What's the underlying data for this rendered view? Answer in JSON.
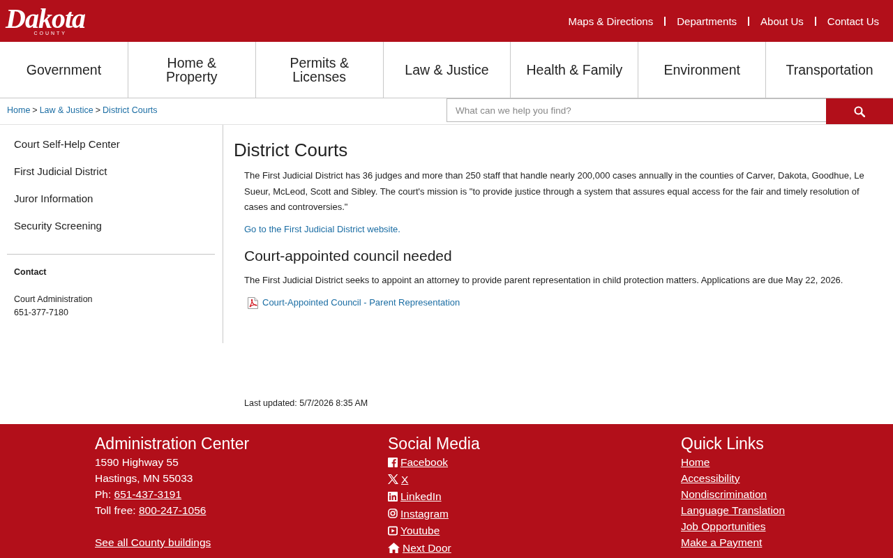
{
  "header": {
    "logo": {
      "wordmark": "Dakota",
      "subtitle": "COUNTY"
    },
    "top_links": [
      "Maps & Directions",
      "Departments",
      "About Us",
      "Contact Us"
    ]
  },
  "nav": [
    {
      "lines": [
        "Government"
      ]
    },
    {
      "lines": [
        "Home &",
        "Property"
      ]
    },
    {
      "lines": [
        "Permits &",
        "Licenses"
      ]
    },
    {
      "lines": [
        "Law & Justice"
      ]
    },
    {
      "lines": [
        "Health & Family"
      ]
    },
    {
      "lines": [
        "Environment"
      ]
    },
    {
      "lines": [
        "Transportation"
      ]
    }
  ],
  "breadcrumb": [
    {
      "label": "Home",
      "separator": ">"
    },
    {
      "label": "Law & Justice",
      "separator": ">"
    },
    {
      "label": "District Courts"
    }
  ],
  "search": {
    "placeholder": "What can we help you find?"
  },
  "sidebar": {
    "items": [
      "Court Self-Help Center",
      "First Judicial District",
      "Juror Information",
      "Security Screening"
    ],
    "contact": {
      "heading": "Contact",
      "lines": [
        "Court Administration",
        "651-377-7180"
      ]
    }
  },
  "content": {
    "title": "District Courts",
    "blocks": [
      {
        "kind": "paragraph",
        "text": "The First Judicial District has 36 judges and more than 250 staff that handle nearly 200,000 cases annually in the counties of Carver, Dakota, Goodhue, Le Sueur, McLeod, Scott and Sibley.  The court's mission is \"to provide justice through a system that assures equal access for the fair and timely resolution of cases and controversies.\""
      },
      {
        "kind": "link",
        "text": "Go to the First Judicial District website."
      },
      {
        "kind": "heading",
        "text": "Court-appointed council needed"
      },
      {
        "kind": "paragraph",
        "text": "The First Judicial District seeks to appoint an attorney to provide parent representation in child protection matters. Applications are due May 22, 2026."
      },
      {
        "kind": "file_link",
        "text": "Court-Appointed Council - Parent Representation"
      }
    ],
    "last_updated": "Last updated: 5/7/2026 8:35 AM"
  },
  "footer": {
    "address": {
      "heading": "Administration Center",
      "lines": [
        {
          "kind": "text",
          "text": "1590 Highway 55"
        },
        {
          "kind": "text",
          "text": "Hastings, MN 55033"
        },
        {
          "kind": "phone",
          "label": "Ph:",
          "link": "651-437-3191"
        },
        {
          "kind": "phone",
          "label": "Toll free:",
          "link": "800-247-1056"
        }
      ],
      "buildings_link": "See all County buildings"
    },
    "social": {
      "heading": "Social Media",
      "links": [
        "Facebook",
        "X",
        "LinkedIn",
        "Instagram",
        "Youtube",
        "Next Door"
      ]
    },
    "quick_links": {
      "heading": "Quick Links",
      "links": [
        "Home",
        "Accessibility",
        "Nondiscrimination",
        "Language Translation",
        "Job Opportunities",
        "Make a Payment"
      ]
    }
  }
}
